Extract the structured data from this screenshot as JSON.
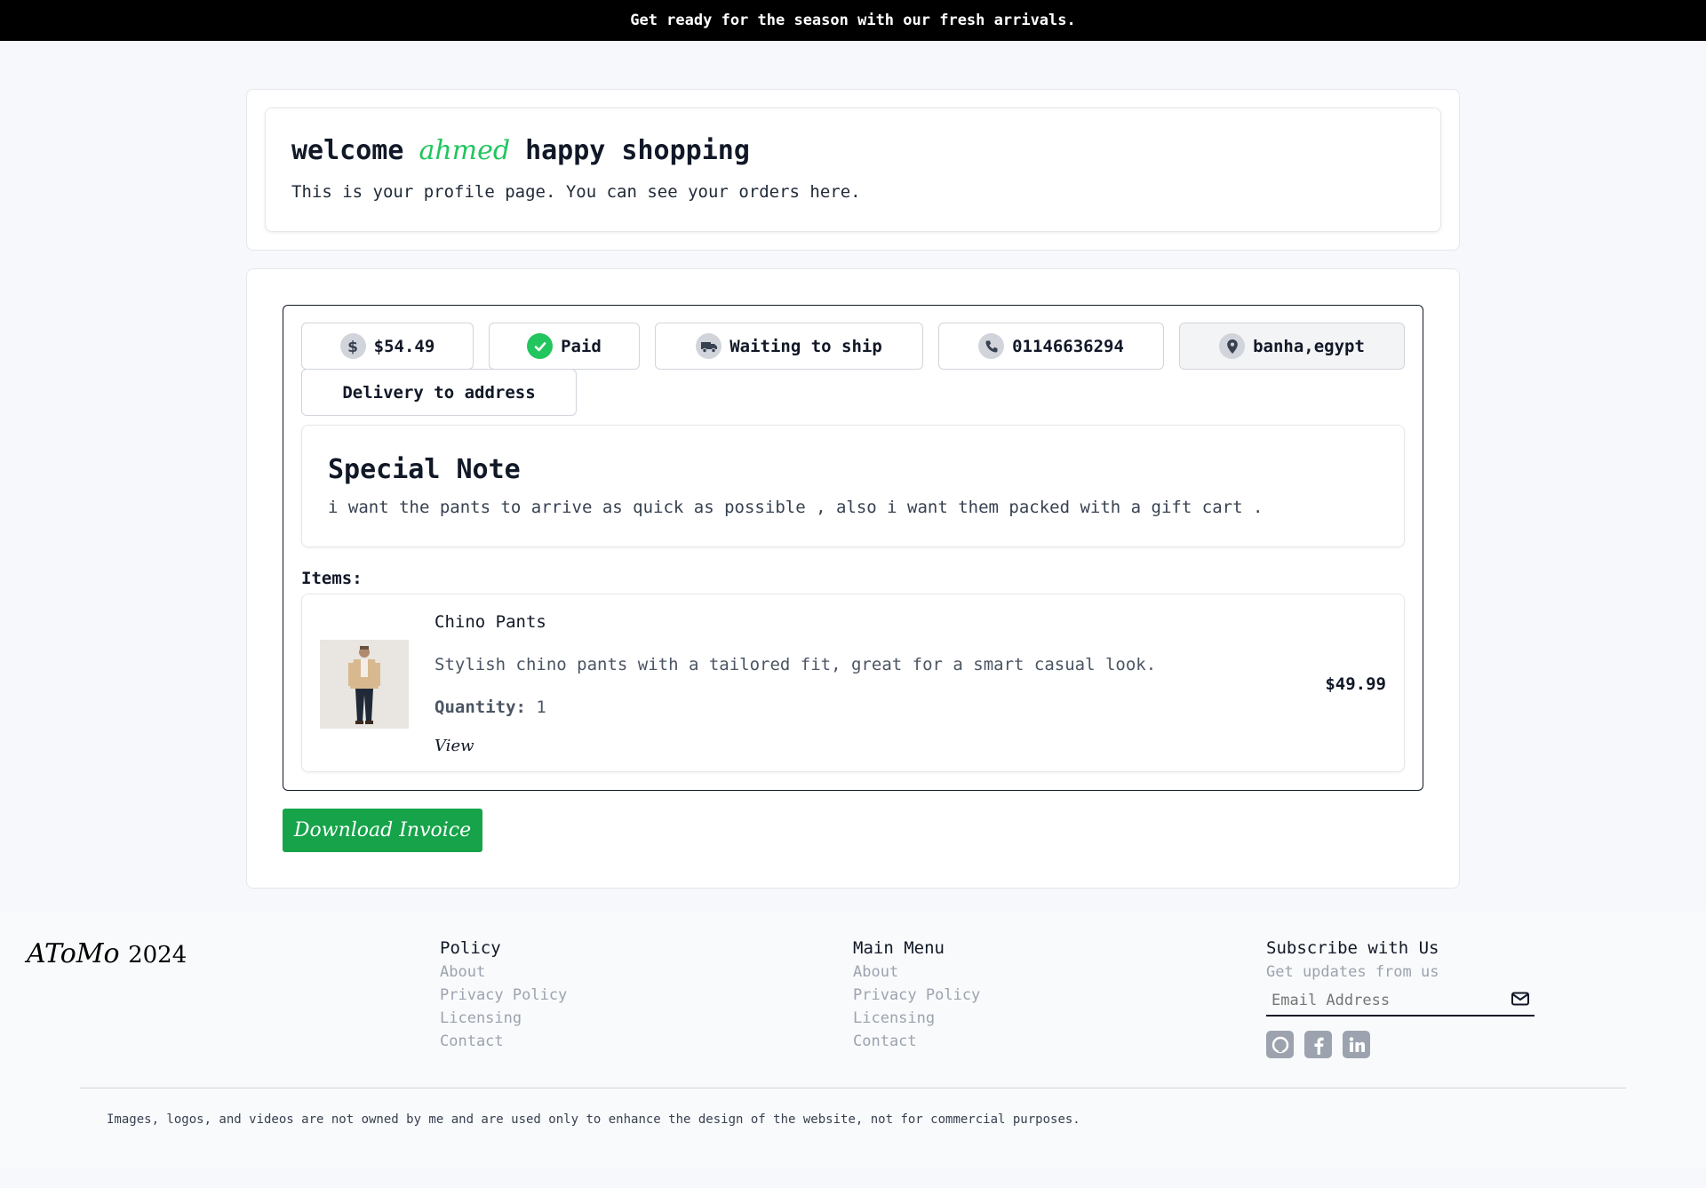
{
  "announcement": "Get ready for the season with our fresh arrivals.",
  "welcome": {
    "prefix": "welcome",
    "name": "ahmed",
    "suffix": "happy shopping",
    "subtitle": "This is your profile page. You can see your orders here."
  },
  "order": {
    "total": "$54.49",
    "payment_status": "Paid",
    "shipping_status": "Waiting to ship",
    "phone": "01146636294",
    "address": "banha,egypt",
    "delivery_method": "Delivery to address",
    "note": {
      "title": "Special Note",
      "text": "i want the pants to arrive as quick as possible , also i want them packed with a gift cart ."
    },
    "items_label": "Items:",
    "items": [
      {
        "name": "Chino Pants",
        "description": "Stylish chino pants with a tailored fit, great for a smart casual look.",
        "quantity_label": "Quantity:",
        "quantity": "1",
        "view_label": "View",
        "price": "$49.99"
      }
    ],
    "download_label": "Download Invoice"
  },
  "footer": {
    "brand": "AToMo",
    "year": "2024",
    "policy": {
      "title": "Policy",
      "links": [
        "About",
        "Privacy Policy",
        "Licensing",
        "Contact"
      ]
    },
    "main_menu": {
      "title": "Main Menu",
      "links": [
        "About",
        "Privacy Policy",
        "Licensing",
        "Contact"
      ]
    },
    "subscribe": {
      "title": "Subscribe with Us",
      "subtitle": "Get updates from us",
      "email_placeholder": "Email Address"
    },
    "social_icons": [
      "github-icon",
      "facebook-icon",
      "linkedin-icon"
    ],
    "disclaimer": "Images, logos, and videos are not owned by me and are used only to enhance the design of the website, not for commercial purposes."
  }
}
